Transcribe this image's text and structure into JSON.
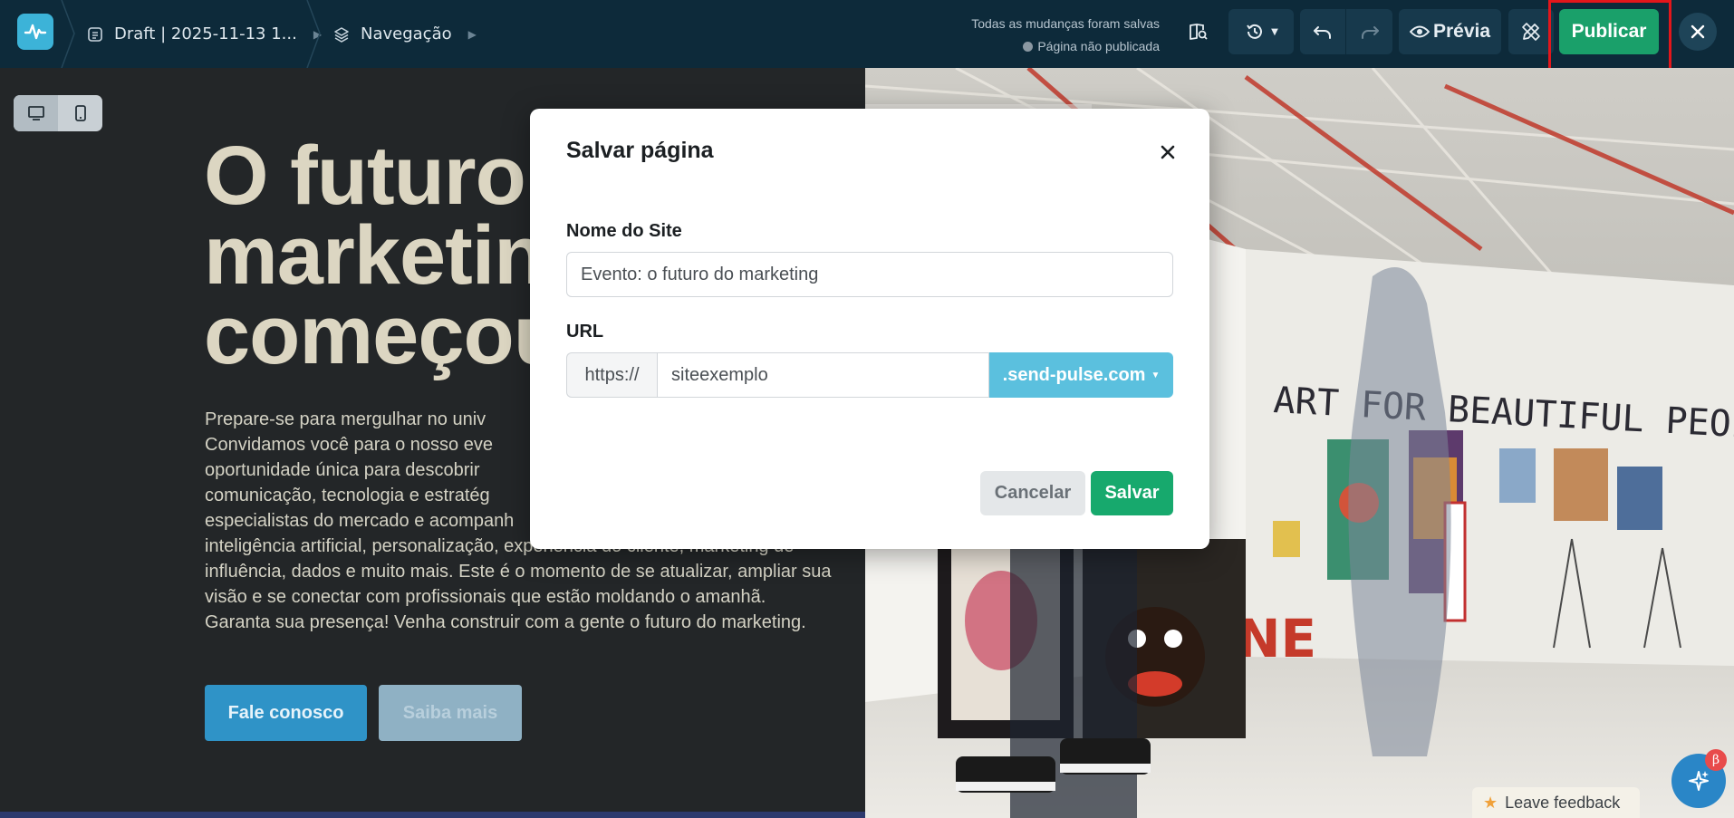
{
  "topbar": {
    "draft_label": "Draft | 2025-11-13 1...",
    "nav_label": "Navegação",
    "status_saved": "Todas as mudanças foram salvas",
    "status_unpublished": "Página não publicada",
    "preview_label": "Prévia",
    "publish_label": "Publicar"
  },
  "hero": {
    "title_lines": [
      "O futuro",
      "marketin",
      "começou"
    ],
    "paragraph_lines": [
      "Prepare-se para mergulhar no univ",
      "Convidamos você para o nosso eve",
      "oportunidade única para descobrir",
      "comunicação, tecnologia e estratég",
      "especialistas do mercado e acompanh",
      "inteligência artificial, personalização, experiência do cliente, marketing de",
      "influência, dados e muito mais. Este é o momento de se atualizar, ampliar sua",
      "visão e se conectar com profissionais que estão moldando o amanhã.",
      "Garanta sua presença! Venha construir com a gente o futuro do marketing."
    ],
    "btn_contact": "Fale conosco",
    "btn_more": "Saiba mais"
  },
  "modal": {
    "title": "Salvar página",
    "site_name_label": "Nome do Site",
    "site_name_value": "Evento: o futuro do marketing",
    "url_label": "URL",
    "url_prefix": "https://",
    "url_value": "siteexemplo",
    "url_domain": ".send-pulse.com",
    "cancel_label": "Cancelar",
    "save_label": "Salvar"
  },
  "image": {
    "mural_text": "ART FOR BEAUTIFUL PEOPLE",
    "sign_text": "NE"
  },
  "feedback_label": "Leave feedback",
  "beta_badge": "β",
  "colors": {
    "topbar": "#0d2a3a",
    "publish": "#1aa06a",
    "save": "#17a96d",
    "domain": "#5bc0de",
    "highlight": "#e3161b"
  }
}
